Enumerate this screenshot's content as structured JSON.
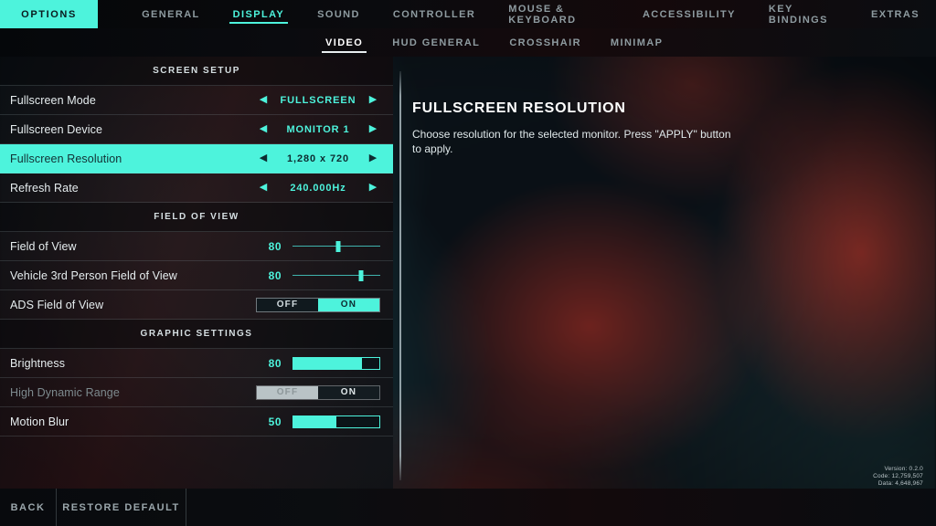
{
  "nav": {
    "options_label": "OPTIONS",
    "items": [
      {
        "label": "GENERAL",
        "active": false
      },
      {
        "label": "DISPLAY",
        "active": true
      },
      {
        "label": "SOUND",
        "active": false
      },
      {
        "label": "CONTROLLER",
        "active": false
      },
      {
        "label": "MOUSE & KEYBOARD",
        "active": false
      },
      {
        "label": "ACCESSIBILITY",
        "active": false
      },
      {
        "label": "KEY BINDINGS",
        "active": false
      },
      {
        "label": "EXTRAS",
        "active": false
      }
    ]
  },
  "subnav": {
    "items": [
      {
        "label": "VIDEO",
        "active": true
      },
      {
        "label": "HUD GENERAL",
        "active": false
      },
      {
        "label": "CROSSHAIR",
        "active": false
      },
      {
        "label": "MINIMAP",
        "active": false
      }
    ]
  },
  "sections": [
    {
      "title": "SCREEN SETUP",
      "rows": [
        {
          "label": "Fullscreen Mode",
          "type": "stepper",
          "value": "FULLSCREEN",
          "left_arrow": "◀",
          "right_arrow": "▶",
          "selected": false
        },
        {
          "label": "Fullscreen Device",
          "type": "stepper",
          "value": "MONITOR 1",
          "left_arrow": "◀",
          "right_arrow": "▶",
          "selected": false
        },
        {
          "label": "Fullscreen Resolution",
          "type": "stepper",
          "value": "1,280 x 720",
          "left_arrow": "◀",
          "right_arrow": "▶",
          "selected": true
        },
        {
          "label": "Refresh Rate",
          "type": "stepper",
          "value": "240.000Hz",
          "left_arrow": "◀",
          "right_arrow": "▶",
          "selected": false
        }
      ]
    },
    {
      "title": "FIELD OF VIEW",
      "rows": [
        {
          "label": "Field of View",
          "type": "slider",
          "value": "80",
          "percent": 52,
          "selected": false
        },
        {
          "label": "Vehicle 3rd Person Field of View",
          "type": "slider",
          "value": "80",
          "percent": 78,
          "selected": false
        },
        {
          "label": "ADS Field of View",
          "type": "toggle",
          "off_label": "OFF",
          "on_label": "ON",
          "state": "ON",
          "disabled": false
        }
      ]
    },
    {
      "title": "GRAPHIC SETTINGS",
      "rows": [
        {
          "label": "Brightness",
          "type": "bar",
          "value": "80",
          "percent": 80,
          "selected": false
        },
        {
          "label": "High Dynamic Range",
          "type": "toggle",
          "off_label": "OFF",
          "on_label": "ON",
          "state": "OFF",
          "disabled": true
        },
        {
          "label": "Motion Blur",
          "type": "bar",
          "value": "50",
          "percent": 50,
          "selected": false
        }
      ]
    }
  ],
  "description": {
    "title": "FULLSCREEN RESOLUTION",
    "body": "Choose resolution for the selected monitor. Press \"APPLY\" button to apply."
  },
  "version": {
    "version_line": "Version: 0.2.0",
    "code_line": "Code: 12,759,507",
    "data_line": "Data: 4,648,967"
  },
  "bottom": {
    "back_label": "BACK",
    "restore_label": "RESTORE DEFAULT"
  },
  "colors": {
    "accent": "#4df3dc",
    "panel_dark": "#0b1014",
    "text": "#e6edef"
  }
}
